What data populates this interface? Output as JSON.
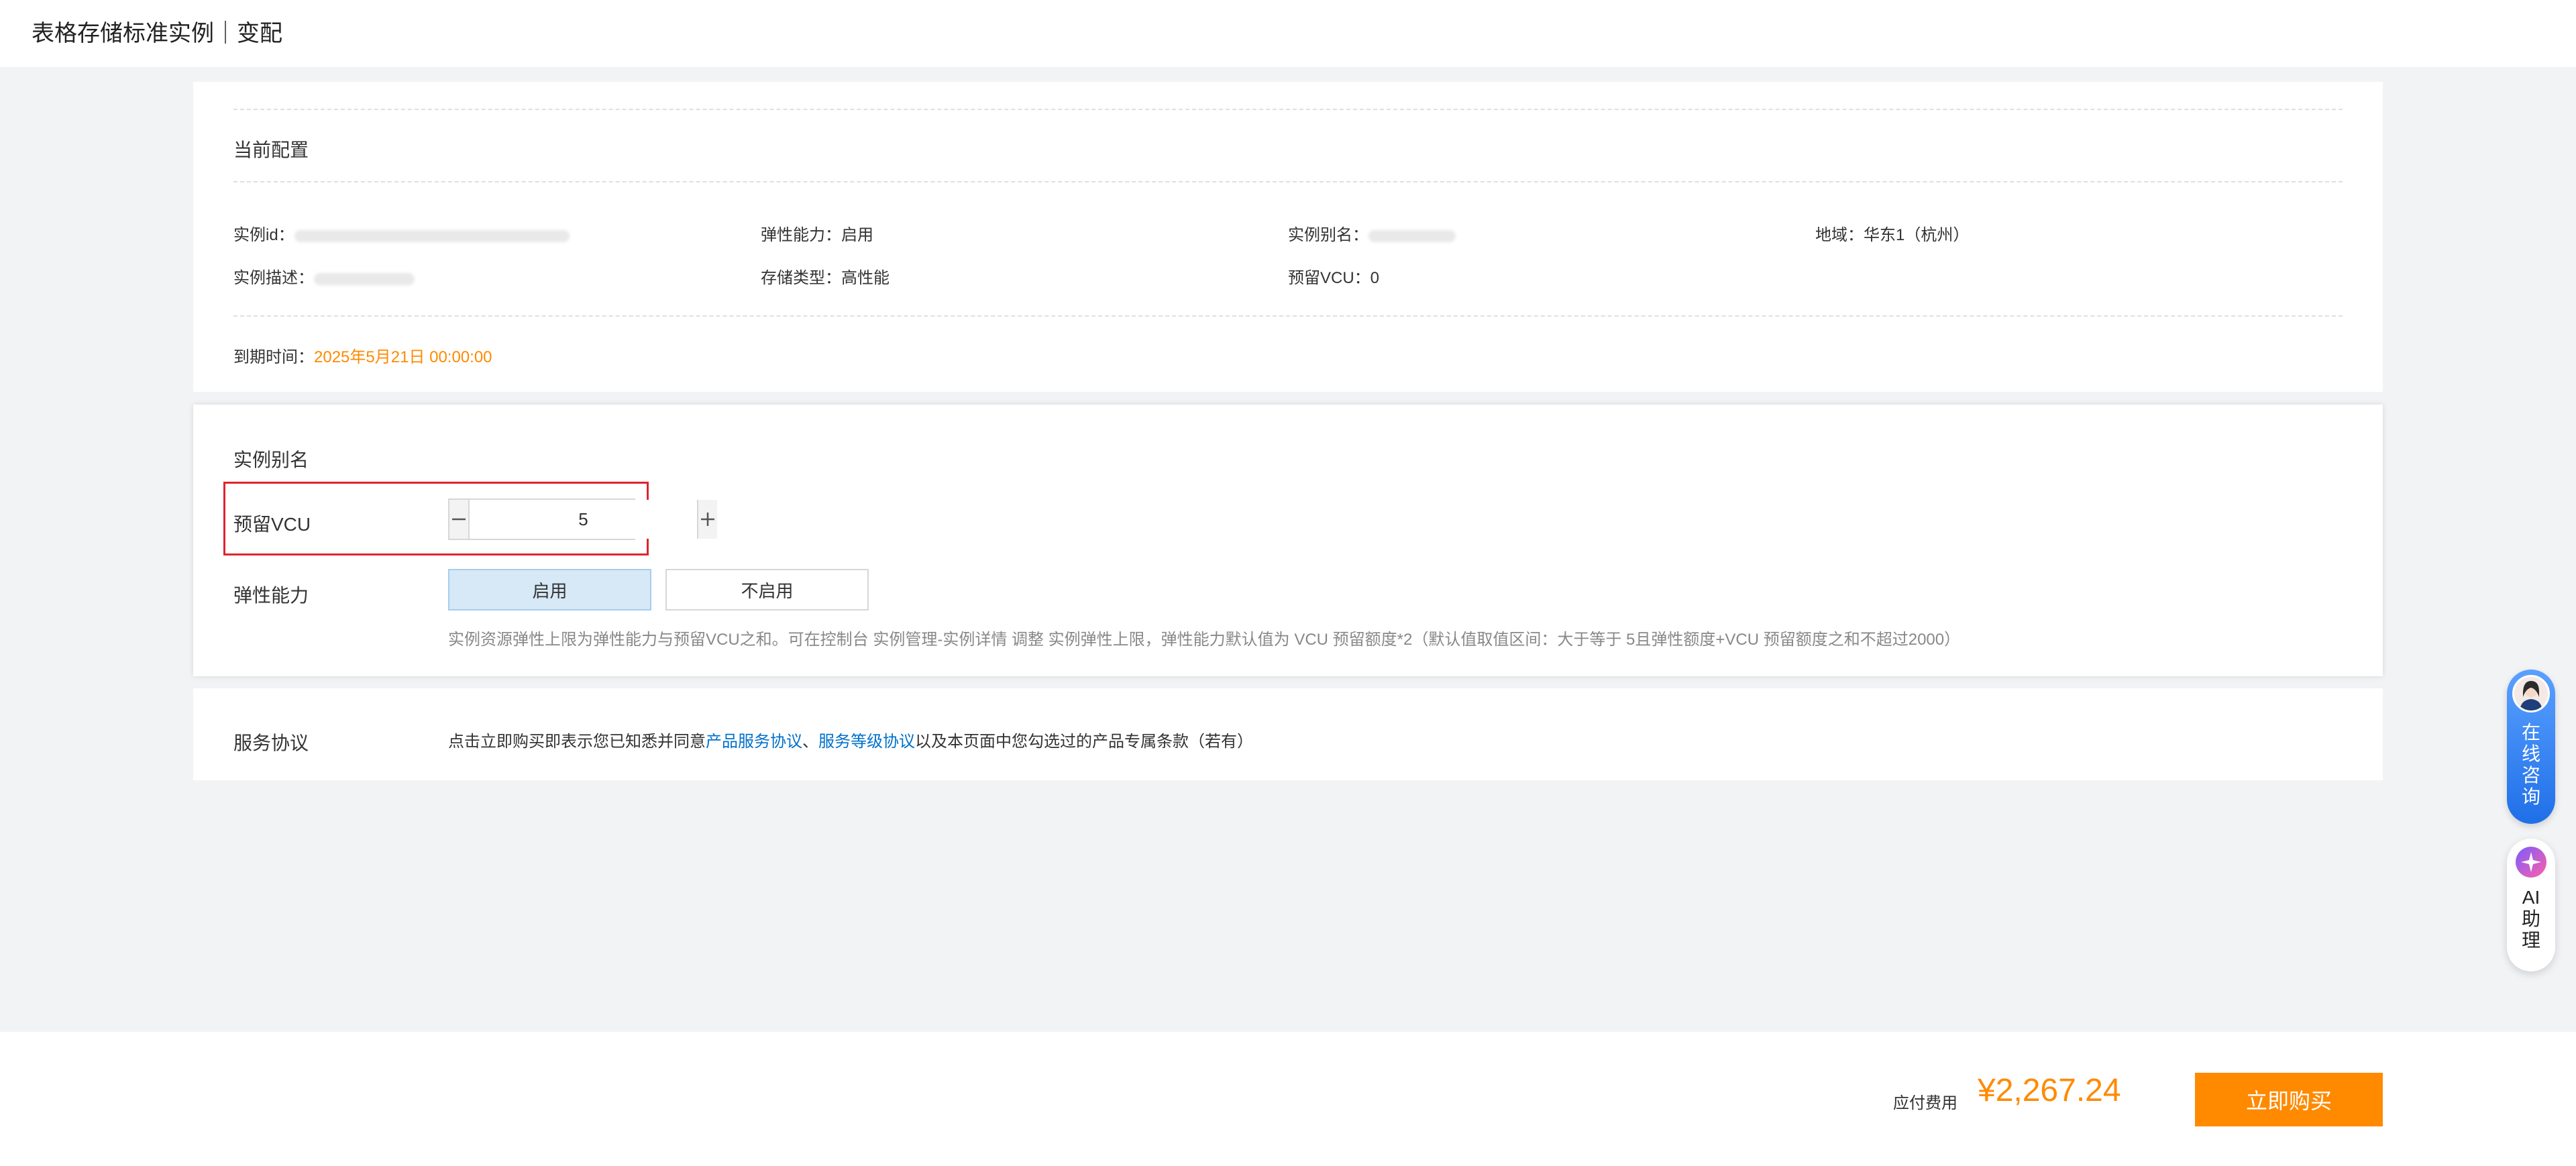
{
  "header": {
    "title": "表格存储标准实例｜变配"
  },
  "current_config": {
    "section_title": "当前配置",
    "instance_id_label": "实例id：",
    "elastic_label": "弹性能力：",
    "elastic_value": "启用",
    "alias_label": "实例别名：",
    "region_label": "地域：",
    "region_value": "华东1（杭州）",
    "desc_label": "实例描述：",
    "storage_label": "存储类型：",
    "storage_value": "高性能",
    "vcu_label": "预留VCU：",
    "vcu_value": "0",
    "expire_label": "到期时间：",
    "expire_value": "2025年5月21日 00:00:00"
  },
  "modify": {
    "alias_title": "实例别名",
    "vcu_label": "预留VCU",
    "vcu_value": "5",
    "elastic_label": "弹性能力",
    "elastic_on": "启用",
    "elastic_off": "不启用",
    "hint": "实例资源弹性上限为弹性能力与预留VCU之和。可在控制台 实例管理-实例详情 调整 实例弹性上限，弹性能力默认值为 VCU 预留额度*2（默认值取值区间：大于等于 5且弹性额度+VCU 预留额度之和不超过2000）"
  },
  "agreement": {
    "label": "服务协议",
    "text_before": "点击立即购买即表示您已知悉并同意",
    "link1": "产品服务协议",
    "sep": "、",
    "link2": "服务等级协议",
    "text_after": "以及本页面中您勾选过的产品专属条款（若有）"
  },
  "footer": {
    "fee_label": "应付费用",
    "fee_value": "¥2,267.24",
    "buy_label": "立即购买"
  },
  "floating": {
    "consult": "在线咨询",
    "ai": "AI助理"
  },
  "colors": {
    "accent": "#ff8a00",
    "link": "#0070cc",
    "highlight": "#e0242f"
  }
}
